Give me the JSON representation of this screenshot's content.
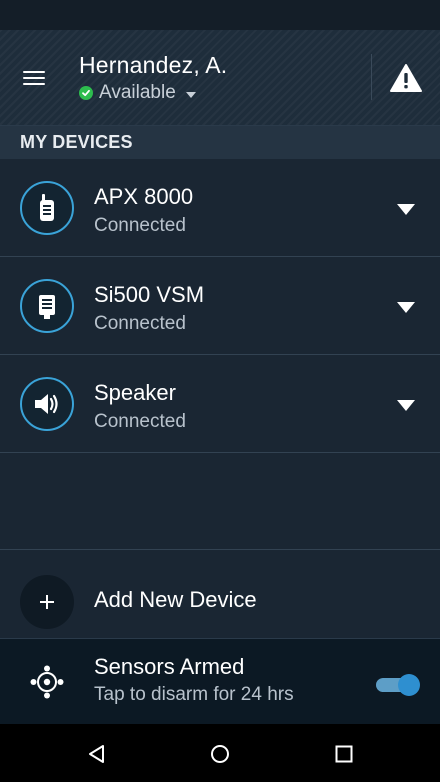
{
  "header": {
    "user_name": "Hernandez, A.",
    "status": "Available",
    "status_color": "#2dbd4e",
    "menu_icon": "hamburger-menu-icon",
    "alert_icon": "warning-triangle-icon"
  },
  "section": {
    "title": "MY DEVICES"
  },
  "devices": [
    {
      "name": "APX 8000",
      "status": "Connected",
      "icon": "radio-icon"
    },
    {
      "name": "Si500 VSM",
      "status": "Connected",
      "icon": "body-camera-icon"
    },
    {
      "name": "Speaker",
      "status": "Connected",
      "icon": "speaker-icon"
    }
  ],
  "add_device": {
    "label": "Add New Device",
    "icon": "plus-icon"
  },
  "sensors": {
    "title": "Sensors Armed",
    "subtitle": "Tap to disarm for 24 hrs",
    "toggle_on": true,
    "icon": "sensor-crosshair-icon"
  },
  "colors": {
    "accent": "#3aa3d8",
    "background": "#1a2633",
    "toggle": "#2e8fd0"
  },
  "nav": {
    "back_icon": "back-triangle-icon",
    "home_icon": "home-circle-icon",
    "recents_icon": "recents-square-icon"
  }
}
